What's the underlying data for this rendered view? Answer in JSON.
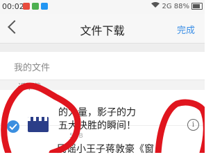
{
  "status_bar": {
    "time": "00:02",
    "right_text": "2G 88%",
    "icons": [
      "notification-icon",
      "app-icon",
      "app-icon-2"
    ],
    "colors": [
      "#e84b3c",
      "#4caf50",
      "#2196f3"
    ]
  },
  "nav": {
    "title": "文件下载",
    "done_label": "完成"
  },
  "my_files": {
    "label": "我的文件"
  },
  "recent_section": {
    "label": "近下载"
  },
  "downloads": [
    {
      "title_line1": "的力量，影子的力",
      "title_line2": "五大决胜的瞬间！",
      "size": "5MB"
    },
    {
      "title": "民谣小王子蒋敦豪《窗"
    }
  ],
  "colors": {
    "accent": "#3a8ee6",
    "scribble": "#e0151e"
  }
}
